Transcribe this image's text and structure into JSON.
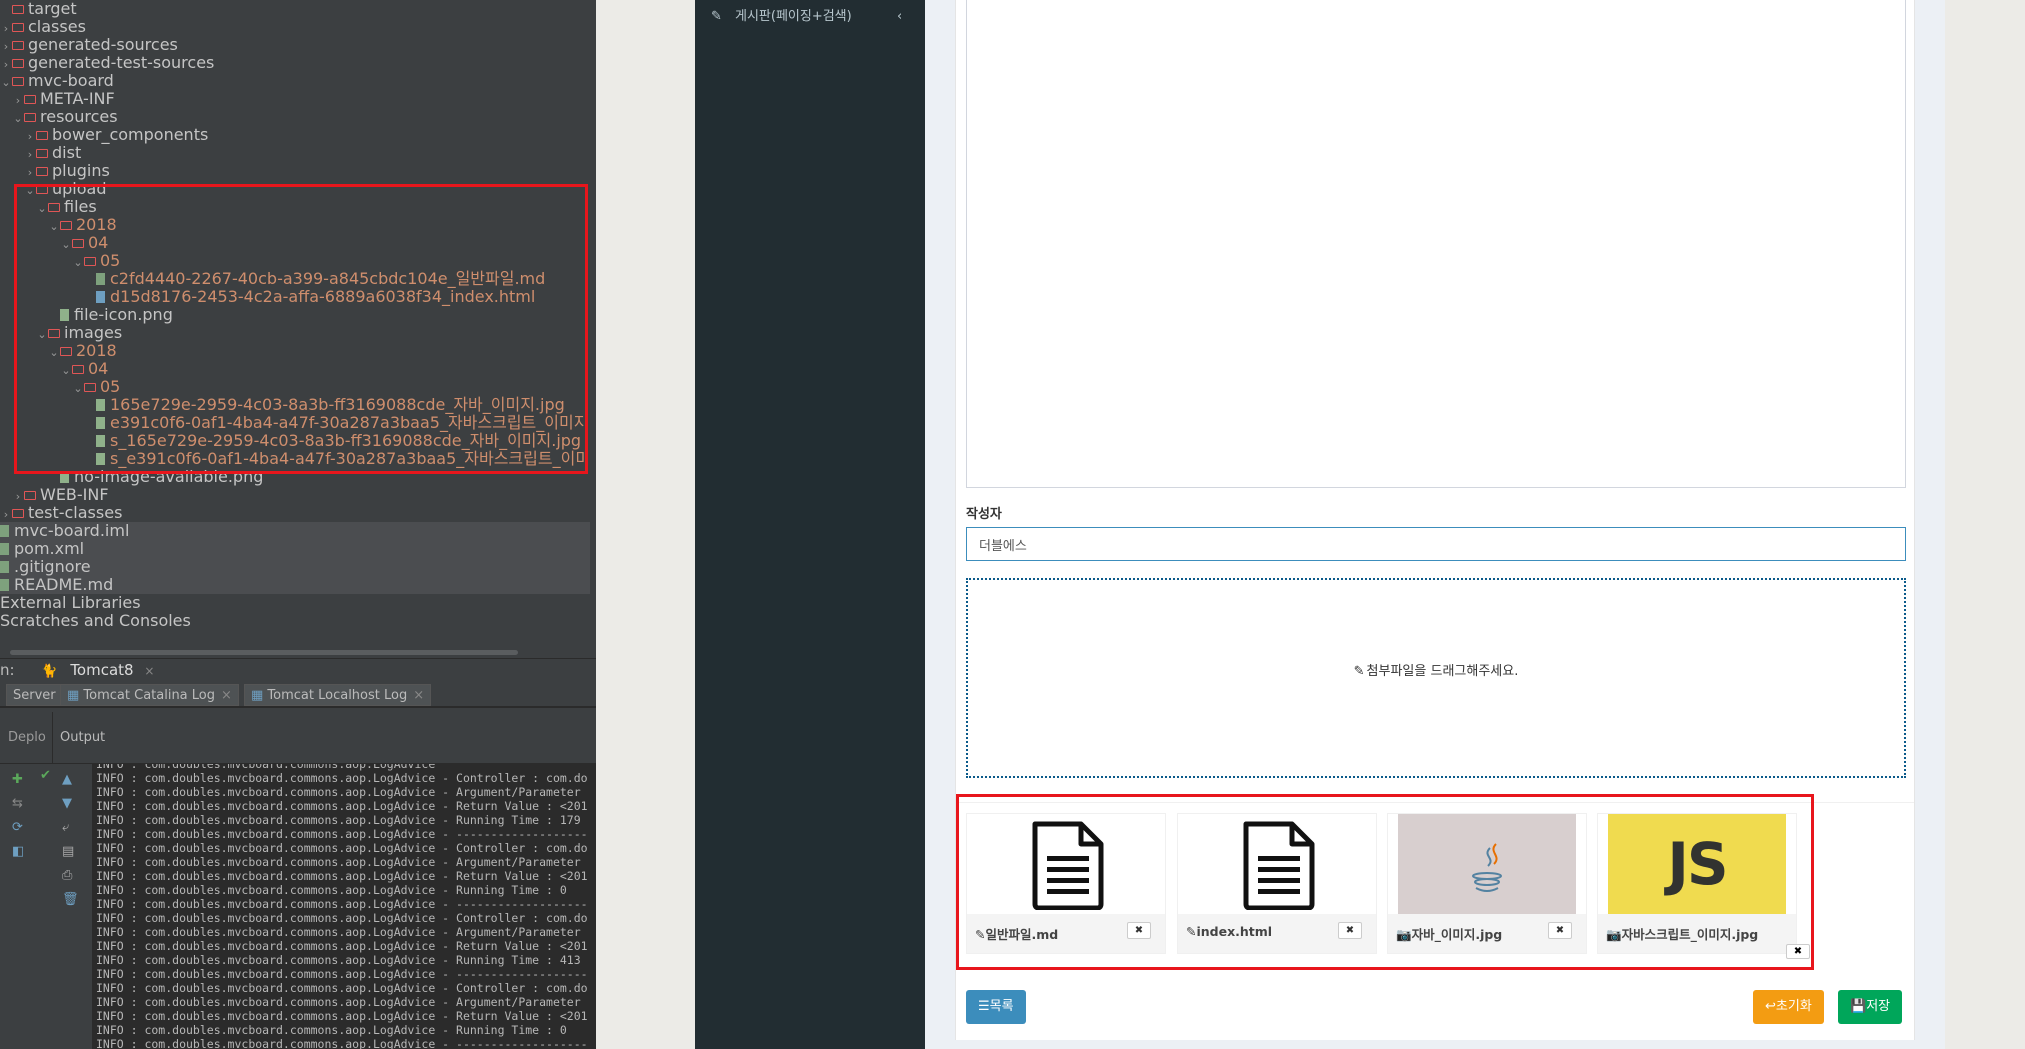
{
  "ide": {
    "tree": [
      {
        "name": "target",
        "type": "folder",
        "indent": 0,
        "arrow": "",
        "color": "white"
      },
      {
        "name": "classes",
        "type": "folder",
        "indent": 0,
        "arrow": ">",
        "color": "white"
      },
      {
        "name": "generated-sources",
        "type": "folder",
        "indent": 0,
        "arrow": ">",
        "color": "white"
      },
      {
        "name": "generated-test-sources",
        "type": "folder",
        "indent": 0,
        "arrow": ">",
        "color": "white"
      },
      {
        "name": "mvc-board",
        "type": "folder",
        "indent": 0,
        "arrow": "v",
        "color": "white"
      },
      {
        "name": "META-INF",
        "type": "folder",
        "indent": 1,
        "arrow": ">",
        "color": "white"
      },
      {
        "name": "resources",
        "type": "folder",
        "indent": 1,
        "arrow": "v",
        "color": "white"
      },
      {
        "name": "bower_components",
        "type": "folder",
        "indent": 2,
        "arrow": ">",
        "color": "white"
      },
      {
        "name": "dist",
        "type": "folder",
        "indent": 2,
        "arrow": ">",
        "color": "white"
      },
      {
        "name": "plugins",
        "type": "folder",
        "indent": 2,
        "arrow": ">",
        "color": "white"
      },
      {
        "name": "upload",
        "type": "folder",
        "indent": 2,
        "arrow": "v",
        "color": "white"
      },
      {
        "name": "files",
        "type": "folder",
        "indent": 3,
        "arrow": "v",
        "color": "white"
      },
      {
        "name": "2018",
        "type": "folder",
        "indent": 4,
        "arrow": "v",
        "color": "orange"
      },
      {
        "name": "04",
        "type": "folder",
        "indent": 5,
        "arrow": "v",
        "color": "orange"
      },
      {
        "name": "05",
        "type": "folder",
        "indent": 6,
        "arrow": "v",
        "color": "orange"
      },
      {
        "name": "c2fd4440-2267-40cb-a399-a845cbdc104e_일반파일.md",
        "type": "file",
        "indent": 7,
        "arrow": "",
        "color": "orange"
      },
      {
        "name": "d15d8176-2453-4c2a-affa-6889a6038f34_index.html",
        "type": "file-html",
        "indent": 7,
        "arrow": "",
        "color": "orange"
      },
      {
        "name": "file-icon.png",
        "type": "file-img",
        "indent": 4,
        "arrow": "",
        "color": "white"
      },
      {
        "name": "images",
        "type": "folder",
        "indent": 3,
        "arrow": "v",
        "color": "white"
      },
      {
        "name": "2018",
        "type": "folder",
        "indent": 4,
        "arrow": "v",
        "color": "orange"
      },
      {
        "name": "04",
        "type": "folder",
        "indent": 5,
        "arrow": "v",
        "color": "orange"
      },
      {
        "name": "05",
        "type": "folder",
        "indent": 6,
        "arrow": "v",
        "color": "orange"
      },
      {
        "name": "165e729e-2959-4c03-8a3b-ff3169088cde_자바_이미지.jpg",
        "type": "file-img",
        "indent": 7,
        "arrow": "",
        "color": "orange"
      },
      {
        "name": "e391c0f6-0af1-4ba4-a47f-30a287a3baa5_자바스크립트_이미지",
        "type": "file-img",
        "indent": 7,
        "arrow": "",
        "color": "orange"
      },
      {
        "name": "s_165e729e-2959-4c03-8a3b-ff3169088cde_자바_이미지.jpg",
        "type": "file-img",
        "indent": 7,
        "arrow": "",
        "color": "orange"
      },
      {
        "name": "s_e391c0f6-0af1-4ba4-a47f-30a287a3baa5_자바스크립트_이미",
        "type": "file-img",
        "indent": 7,
        "arrow": "",
        "color": "orange"
      },
      {
        "name": "no-image-available.png",
        "type": "file-img",
        "indent": 4,
        "arrow": "",
        "color": "white"
      },
      {
        "name": "WEB-INF",
        "type": "folder",
        "indent": 1,
        "arrow": ">",
        "color": "white"
      },
      {
        "name": "test-classes",
        "type": "folder",
        "indent": 0,
        "arrow": ">",
        "color": "white"
      },
      {
        "name": "mvc-board.iml",
        "type": "file",
        "indent": -1,
        "arrow": "",
        "color": "white",
        "sel": true
      },
      {
        "name": "pom.xml",
        "type": "file",
        "indent": -1,
        "arrow": "",
        "color": "white",
        "sel": true
      },
      {
        "name": ".gitignore",
        "type": "file",
        "indent": -1,
        "arrow": "",
        "color": "white",
        "sel": true
      },
      {
        "name": "README.md",
        "type": "file",
        "indent": -1,
        "arrow": "",
        "color": "white",
        "sel": true
      },
      {
        "name": "External Libraries",
        "type": "none",
        "indent": -1,
        "arrow": "",
        "color": "white"
      },
      {
        "name": "Scratches and Consoles",
        "type": "none",
        "indent": -1,
        "arrow": "",
        "color": "white"
      }
    ],
    "run": {
      "prefix": "n:",
      "config": "Tomcat8"
    },
    "tabs": {
      "server": "Server",
      "catalina": "Tomcat Catalina Log",
      "localhost": "Tomcat Localhost Log"
    },
    "output_header": {
      "deploy": "Deplo",
      "output": "Output"
    },
    "log": [
      "INFO : com.doubles.mvcboard.commons.aop.LogAdvice",
      "INFO : com.doubles.mvcboard.commons.aop.LogAdvice - Controller : com.do",
      "INFO : com.doubles.mvcboard.commons.aop.LogAdvice - Argument/Parameter",
      "INFO : com.doubles.mvcboard.commons.aop.LogAdvice - Return Value : <201",
      "INFO : com.doubles.mvcboard.commons.aop.LogAdvice - Running Time : 179",
      "INFO : com.doubles.mvcboard.commons.aop.LogAdvice - -------------------",
      "INFO : com.doubles.mvcboard.commons.aop.LogAdvice - Controller : com.do",
      "INFO : com.doubles.mvcboard.commons.aop.LogAdvice - Argument/Parameter",
      "INFO : com.doubles.mvcboard.commons.aop.LogAdvice - Return Value : <201",
      "INFO : com.doubles.mvcboard.commons.aop.LogAdvice - Running Time : 0",
      "INFO : com.doubles.mvcboard.commons.aop.LogAdvice - -------------------",
      "INFO : com.doubles.mvcboard.commons.aop.LogAdvice - Controller : com.do",
      "INFO : com.doubles.mvcboard.commons.aop.LogAdvice - Argument/Parameter",
      "INFO : com.doubles.mvcboard.commons.aop.LogAdvice - Return Value : <201",
      "INFO : com.doubles.mvcboard.commons.aop.LogAdvice - Running Time : 413",
      "INFO : com.doubles.mvcboard.commons.aop.LogAdvice - -------------------",
      "INFO : com.doubles.mvcboard.commons.aop.LogAdvice - Controller : com.do",
      "INFO : com.doubles.mvcboard.commons.aop.LogAdvice - Argument/Parameter",
      "INFO : com.doubles.mvcboard.commons.aop.LogAdvice - Return Value : <201",
      "INFO : com.doubles.mvcboard.commons.aop.LogAdvice - Running Time : 0",
      "INFO : com.doubles.mvcboard.commons.aop.LogAdvice - -------------------"
    ]
  },
  "sidebar": {
    "menu_label": "게시판(페이징+검색)"
  },
  "form": {
    "writer_label": "작성자",
    "writer_value": "더블에스",
    "drop_text": "첨부파일을 드래그해주세요."
  },
  "attachments": [
    {
      "name": "일반파일.md",
      "kind": "doc"
    },
    {
      "name": "index.html",
      "kind": "doc"
    },
    {
      "name": "자바_이미지.jpg",
      "kind": "java"
    },
    {
      "name": "자바스크립트_이미지.jpg",
      "kind": "js",
      "thumb_text": "JS"
    }
  ],
  "buttons": {
    "list": "목록",
    "reset": "초기화",
    "save": "저장"
  },
  "colors": {
    "accent_blue": "#3c8dbc",
    "warning": "#f39c12",
    "success": "#00a65a",
    "highlight_red": "#e8161c"
  }
}
